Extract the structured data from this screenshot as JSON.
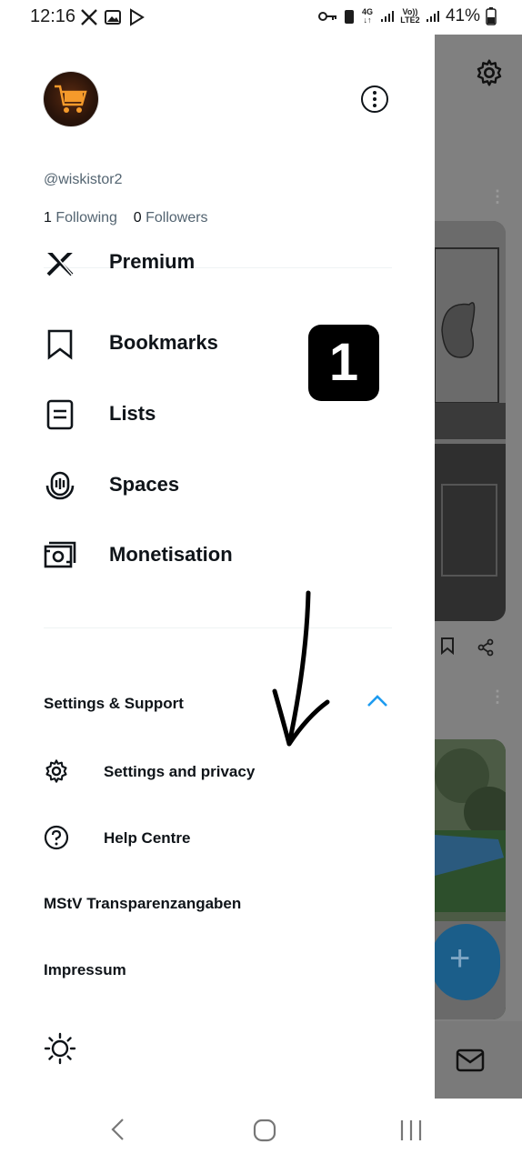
{
  "status_bar": {
    "time": "12:16",
    "network_top": "4G",
    "volte_top": "Vo))",
    "volte_bottom": "LTE2",
    "battery": "41%"
  },
  "drawer": {
    "handle": "@wiskistor2",
    "following_count": "1",
    "following_label": "Following",
    "followers_count": "0",
    "followers_label": "Followers",
    "nav_items": [
      {
        "label": "Premium",
        "icon": "x-logo-icon"
      },
      {
        "label": "Bookmarks",
        "icon": "bookmark-icon"
      },
      {
        "label": "Lists",
        "icon": "list-icon"
      },
      {
        "label": "Spaces",
        "icon": "spaces-icon"
      },
      {
        "label": "Monetisation",
        "icon": "money-icon"
      }
    ],
    "section_title": "Settings & Support",
    "sub_items": [
      {
        "label": "Settings and privacy",
        "icon": "gear-icon"
      },
      {
        "label": "Help Centre",
        "icon": "help-icon"
      }
    ],
    "plain_items": [
      "MStV Transparenzangaben",
      "Impressum"
    ],
    "accent_color": "#1d9bf0"
  },
  "annotation": {
    "badge_number": "1"
  }
}
